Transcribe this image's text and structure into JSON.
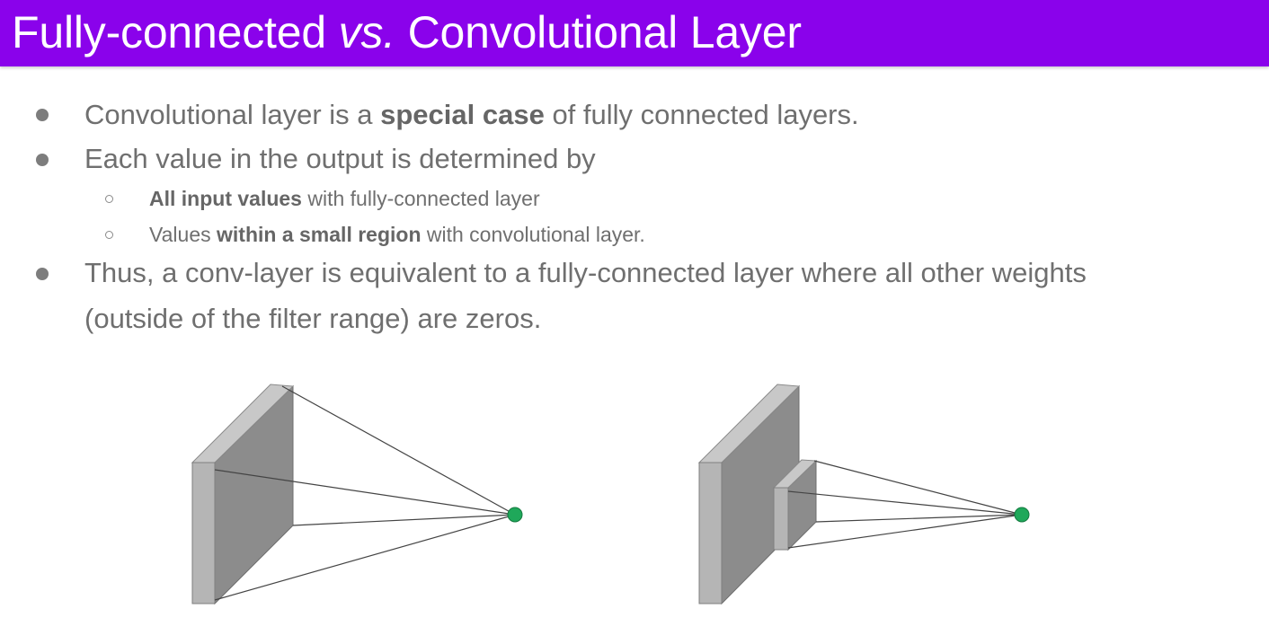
{
  "title": {
    "part1": "Fully-connected ",
    "vs": "vs.",
    "part2": " Convolutional Layer"
  },
  "bullets": [
    {
      "pre": "Convolutional layer is a ",
      "bold": "special case",
      "post": " of fully connected layers."
    },
    {
      "text": "Each value in the output is determined by"
    },
    {
      "line1": "Thus, a conv-layer is equivalent to a fully-connected layer where all other weights",
      "line2": "(outside of the filter range) are zeros."
    }
  ],
  "sub_bullets": [
    {
      "bold": "All input values",
      "post": " with fully-connected layer"
    },
    {
      "pre": "Values ",
      "bold": "within a small region",
      "post": " with convolutional layer."
    }
  ],
  "colors": {
    "title_bar": "#8a02eb",
    "output_node": "#1fa85a",
    "layer_front": "#b5b5b5",
    "layer_side": "#8c8c8c",
    "layer_top": "#c8c8c8"
  },
  "icons": {
    "bullet": "filled-circle",
    "sub_bullet": "hollow-circle"
  }
}
